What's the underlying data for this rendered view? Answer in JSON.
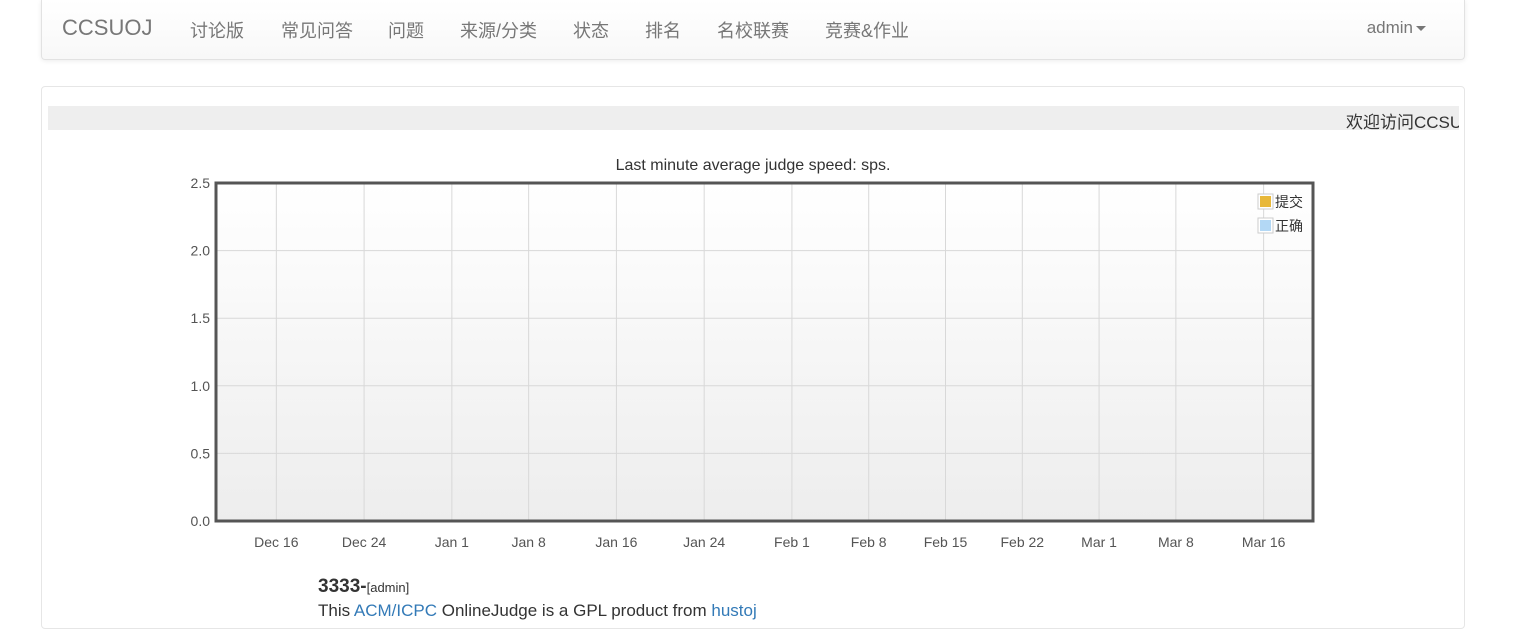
{
  "navbar": {
    "brand": "CCSUOJ",
    "items": [
      "讨论版",
      "常见问答",
      "问题",
      "来源/分类",
      "状态",
      "排名",
      "名校联赛",
      "竞赛&作业"
    ],
    "user": "admin"
  },
  "marquee": {
    "text": "欢迎访问CCSUOJ"
  },
  "chart_data": {
    "type": "line",
    "title": "Last minute average judge speed: sps.",
    "x_ticks": [
      "Dec 16",
      "Dec 24",
      "Jan 1",
      "Jan 8",
      "Jan 16",
      "Jan 24",
      "Feb 1",
      "Feb 8",
      "Feb 15",
      "Feb 22",
      "Mar 1",
      "Mar 8",
      "Mar 16"
    ],
    "y_ticks": [
      "0.0",
      "0.5",
      "1.0",
      "1.5",
      "2.0",
      "2.5"
    ],
    "ylim": [
      0,
      2.5
    ],
    "grid": true,
    "legend_position": "top-right",
    "series": [
      {
        "name": "提交",
        "color": "#e8b83a",
        "values": []
      },
      {
        "name": "正确",
        "color": "#b3d8f5",
        "values": []
      }
    ]
  },
  "footer": {
    "count": "3333",
    "dash": "-",
    "author": "[admin]",
    "line_prefix": "This ",
    "link1": "ACM/ICPC",
    "line_middle": " OnlineJudge is a GPL product from ",
    "link2": "hustoj"
  }
}
